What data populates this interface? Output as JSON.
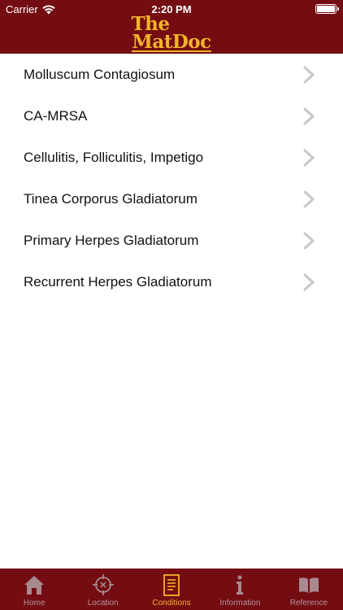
{
  "status_bar": {
    "carrier": "Carrier",
    "time": "2:20 PM"
  },
  "header": {
    "logo_line1": "The",
    "logo_line2": "MatDoc"
  },
  "conditions": [
    {
      "label": "Molluscum Contagiosum"
    },
    {
      "label": "CA-MRSA"
    },
    {
      "label": "Cellulitis, Folliculitis, Impetigo"
    },
    {
      "label": "Tinea Corporus Gladiatorum"
    },
    {
      "label": "Primary Herpes Gladiatorum"
    },
    {
      "label": "Recurrent Herpes Gladiatorum"
    }
  ],
  "tabs": [
    {
      "label": "Home",
      "icon": "home-icon",
      "active": false
    },
    {
      "label": "Location",
      "icon": "crosshair-icon",
      "active": false
    },
    {
      "label": "Conditions",
      "icon": "clipboard-icon",
      "active": true
    },
    {
      "label": "Information",
      "icon": "info-icon",
      "active": false
    },
    {
      "label": "Reference",
      "icon": "book-icon",
      "active": false
    }
  ],
  "colors": {
    "brand": "#730d12",
    "accent": "#f2b32a",
    "inactive": "#b4949a"
  }
}
